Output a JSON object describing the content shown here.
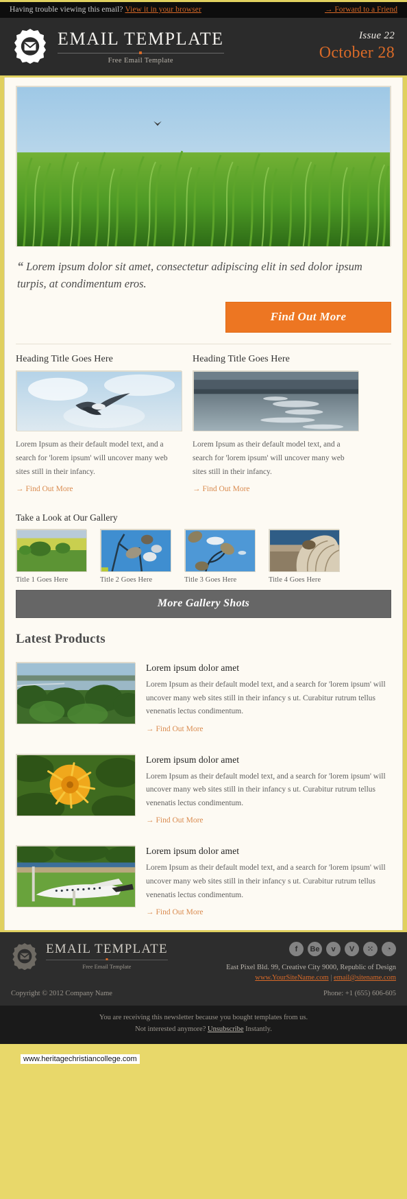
{
  "preheader": {
    "trouble_text": "Having trouble viewing this email?",
    "browser_link": "View it in your browser",
    "forward_link": "→ Forward to a Friend"
  },
  "header": {
    "brand_title": "EMAIL TEMPLATE",
    "brand_sub": "Free Email Template",
    "issue_label": "Issue 22",
    "issue_date": "October 28",
    "logo_icon": "envelope-badge-icon"
  },
  "hero": {
    "alt": "green reeds against blue sky"
  },
  "quote": {
    "mark": "“",
    "text": "Lorem ipsum dolor sit amet, consectetur adipiscing elit in sed dolor ipsum turpis, at condimentum eros."
  },
  "cta_main": {
    "label": "Find Out More"
  },
  "columns": [
    {
      "heading": "Heading Title Goes Here",
      "copy": "Lorem Ipsum as their default model text, and a search for 'lorem ipsum' will uncover many web sites still in their infancy.",
      "link": "Find Out More",
      "image_alt": "seagull flying in sky"
    },
    {
      "heading": "Heading Title Goes Here",
      "copy": "Lorem Ipsum as their default model text, and a search for 'lorem ipsum' will uncover many web sites still in their infancy.",
      "link": "Find Out More",
      "image_alt": "sunlit sea and coastline"
    }
  ],
  "gallery": {
    "heading": "Take a Look at Our Gallery",
    "items": [
      {
        "caption": "Title 1 Goes Here",
        "image_alt": "green field with trees"
      },
      {
        "caption": "Title 2 Goes Here",
        "image_alt": "seed pods against blue sky"
      },
      {
        "caption": "Title 3 Goes Here",
        "image_alt": "dried flower heads on blue sky"
      },
      {
        "caption": "Title 4 Goes Here",
        "image_alt": "close up of shell texture"
      }
    ],
    "cta_label": "More Gallery Shots"
  },
  "latest_products": {
    "title": "Latest Products",
    "items": [
      {
        "name": "Lorem ipsum dolor amet",
        "copy": "Lorem Ipsum as their default model text, and a search for 'lorem ipsum' will uncover many web sites still in their infancy s ut. Curabitur rutrum tellus venenatis lectus condimentum.",
        "link": "Find Out More",
        "image_alt": "lake with green shrubs"
      },
      {
        "name": "Lorem ipsum dolor amet",
        "copy": "Lorem Ipsum as their default model text, and a search for 'lorem ipsum' will uncover many web sites still in their infancy s ut. Curabitur rutrum tellus venenatis lectus condimentum.",
        "link": "Find Out More",
        "image_alt": "yellow dandelion flower close up"
      },
      {
        "name": "Lorem ipsum dolor amet",
        "copy": "Lorem Ipsum as their default model text, and a search for 'lorem ipsum' will uncover many web sites still in their infancy s ut. Curabitur rutrum tellus venenatis lectus condimentum.",
        "link": "Find Out More",
        "image_alt": "white airplane parked on grass"
      }
    ]
  },
  "footer": {
    "brand_title": "EMAIL TEMPLATE",
    "brand_sub": "Free Email Template",
    "socials": [
      {
        "name": "facebook-icon",
        "glyph": "f"
      },
      {
        "name": "behance-icon",
        "glyph": "Be"
      },
      {
        "name": "twitter-icon",
        "glyph": "ᴠ"
      },
      {
        "name": "vimeo-icon",
        "glyph": "V"
      },
      {
        "name": "flickr-icon",
        "glyph": "⁙"
      },
      {
        "name": "rss-icon",
        "glyph": "◔"
      }
    ],
    "address": "East Pixel Bld. 99, Creative City 9000, Republic of Design",
    "site_link": "www.YourSiteName.com",
    "separator": "|",
    "email_link": "email@sitename.com",
    "copyright": "Copyright © 2012 Company Name",
    "phone": "Phone: +1 (655) 606-605"
  },
  "legal": {
    "line1": "You are receiving this newsletter because you bought templates from us.",
    "line2_pre": "Not interested anymore?",
    "line2_link": "Unsubscribe",
    "line2_post": "Instantly."
  },
  "watermark": {
    "text": "www.heritagechristiancollege.com"
  },
  "colors": {
    "frame": "#e0d05f",
    "accent_orange": "#ed7622",
    "dark": "#2b2b2b",
    "gallery_cta": "#666666",
    "card_bg": "#fdfaf3"
  }
}
